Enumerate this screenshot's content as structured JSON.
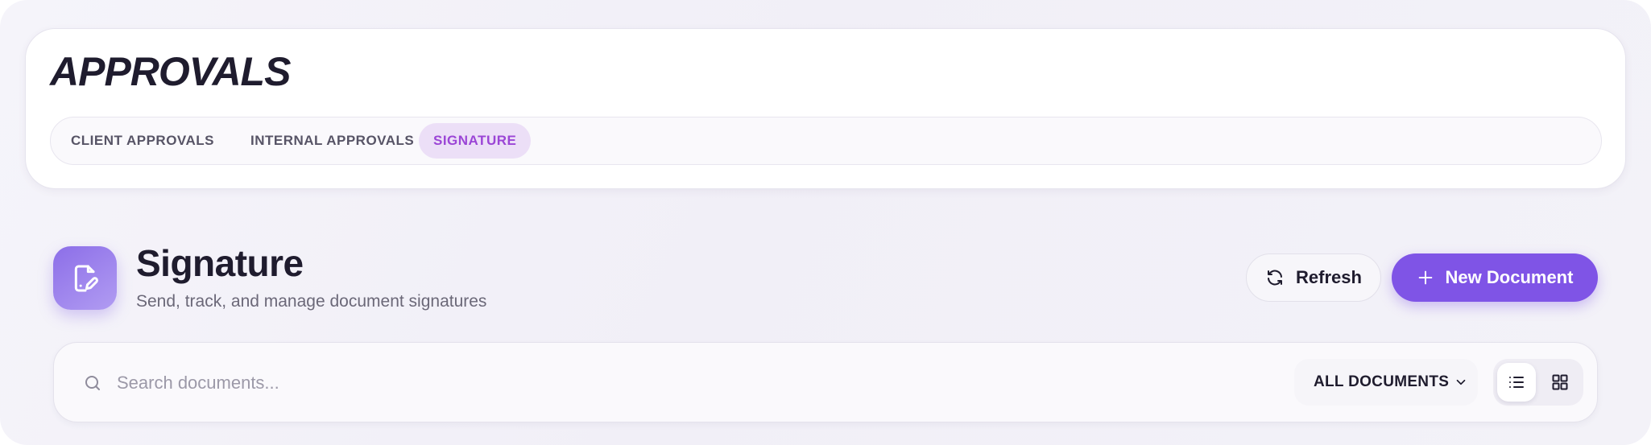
{
  "header": {
    "title": "APPROVALS",
    "tabs": [
      {
        "label": "CLIENT APPROVALS",
        "active": false
      },
      {
        "label": "INTERNAL APPROVALS",
        "active": false
      },
      {
        "label": "SIGNATURE",
        "active": true
      }
    ]
  },
  "section": {
    "icon": "file-signature-icon",
    "title": "Signature",
    "subtitle": "Send, track, and manage document signatures",
    "refresh_label": "Refresh",
    "new_document_label": "New Document"
  },
  "search": {
    "placeholder": "Search documents...",
    "value": ""
  },
  "filter": {
    "selected": "ALL DOCUMENTS"
  },
  "view": {
    "active": "list",
    "options": [
      "list",
      "grid"
    ]
  },
  "colors": {
    "accent": "#7f54e6",
    "active_tab_bg": "#ecdff7",
    "active_tab_text": "#9b45d6",
    "text_primary": "#1f1c2e"
  }
}
